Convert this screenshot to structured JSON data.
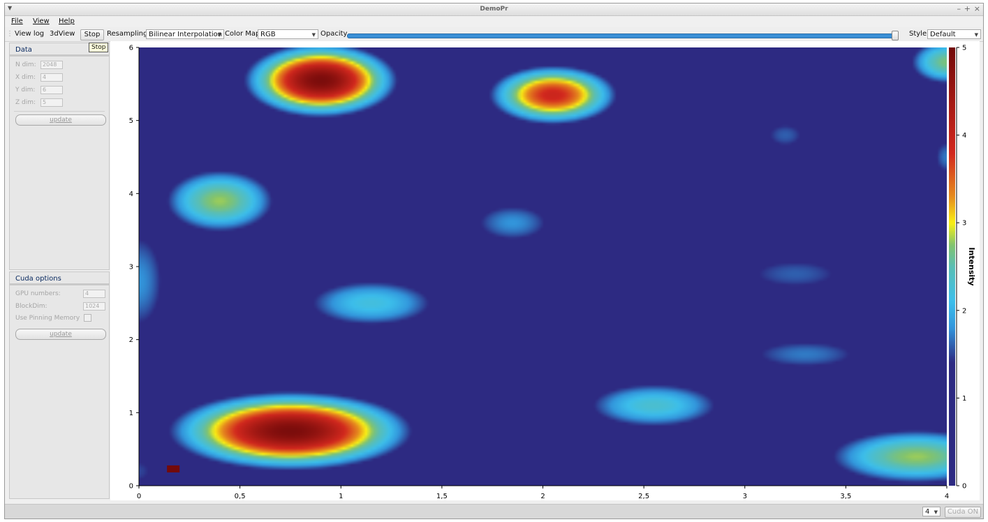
{
  "window": {
    "title": "DemoPr"
  },
  "menu": {
    "file": "File",
    "view": "View",
    "help": "Help"
  },
  "toolbar": {
    "view_log": "View log",
    "view_3d": "3dView",
    "stop": "Stop",
    "resampling_label": "Resampling",
    "resampling_value": "Bilinear Interpolation",
    "colormap_label": "Color Map",
    "colormap_value": "RGB",
    "opacity_label": "Opacity",
    "opacity_value": 1.0,
    "style_label": "Style",
    "style_value": "Default"
  },
  "tooltip": "Stop",
  "data_panel": {
    "title": "Data",
    "n_dim_label": "N dim:",
    "n_dim": "2048",
    "x_dim_label": "X dim:",
    "x_dim": "4",
    "y_dim_label": "Y dim:",
    "y_dim": "6",
    "z_dim_label": "Z dim:",
    "z_dim": "5",
    "update": "update"
  },
  "cuda_panel": {
    "title": "Cuda options",
    "gpu_label": "GPU numbers:",
    "gpu": "4",
    "block_label": "BlockDim:",
    "block": "1024",
    "pin_label": "Use Pinning Memory",
    "update": "update"
  },
  "status": {
    "gpu_select": "4",
    "cuda_button": "Cuda ON"
  },
  "colors": {
    "accent": "#3a8fd6"
  },
  "chart_data": {
    "type": "heatmap",
    "xlim": [
      0,
      4
    ],
    "ylim": [
      0,
      6
    ],
    "zlim": [
      0,
      5
    ],
    "x_ticks": [
      "0",
      "0,5",
      "1",
      "1,5",
      "2",
      "2,5",
      "3",
      "3,5",
      "4"
    ],
    "y_ticks": [
      "0",
      "1",
      "2",
      "3",
      "4",
      "5",
      "6"
    ],
    "colorbar_ticks": [
      "0",
      "1",
      "2",
      "3",
      "4",
      "5"
    ],
    "colorbar_label": "Intensity",
    "colormap": "RGB",
    "peaks": [
      {
        "x": 0.9,
        "y": 5.55,
        "sx": 0.24,
        "sy": 0.32,
        "v": 4.9
      },
      {
        "x": 0.75,
        "y": 0.75,
        "sx": 0.38,
        "sy": 0.34,
        "v": 4.9
      },
      {
        "x": 2.05,
        "y": 5.35,
        "sx": 0.22,
        "sy": 0.28,
        "v": 3.9
      },
      {
        "x": 0.4,
        "y": 3.9,
        "sx": 0.22,
        "sy": 0.35,
        "v": 2.8
      },
      {
        "x": 1.15,
        "y": 2.5,
        "sx": 0.3,
        "sy": 0.3,
        "v": 2.2
      },
      {
        "x": 1.85,
        "y": 3.6,
        "sx": 0.22,
        "sy": 0.3,
        "v": 1.8
      },
      {
        "x": 2.55,
        "y": 1.1,
        "sx": 0.3,
        "sy": 0.28,
        "v": 2.3
      },
      {
        "x": 3.25,
        "y": 2.9,
        "sx": 0.35,
        "sy": 0.3,
        "v": 1.6
      },
      {
        "x": 3.2,
        "y": 4.8,
        "sx": 0.14,
        "sy": 0.25,
        "v": 1.6
      },
      {
        "x": 3.3,
        "y": 1.8,
        "sx": 0.35,
        "sy": 0.25,
        "v": 1.7
      },
      {
        "x": 3.85,
        "y": 0.4,
        "sx": 0.35,
        "sy": 0.3,
        "v": 2.8
      },
      {
        "x": 4.0,
        "y": 5.8,
        "sx": 0.15,
        "sy": 0.25,
        "v": 2.7
      },
      {
        "x": 4.0,
        "y": 4.5,
        "sx": 0.08,
        "sy": 0.3,
        "v": 1.7
      },
      {
        "x": 0.0,
        "y": 2.8,
        "sx": 0.15,
        "sy": 0.8,
        "v": 1.8
      },
      {
        "x": 0.0,
        "y": 0.2,
        "sx": 0.12,
        "sy": 0.3,
        "v": 1.5
      }
    ],
    "marker": {
      "x": 0.17,
      "y": 0.23,
      "value": 5
    }
  }
}
